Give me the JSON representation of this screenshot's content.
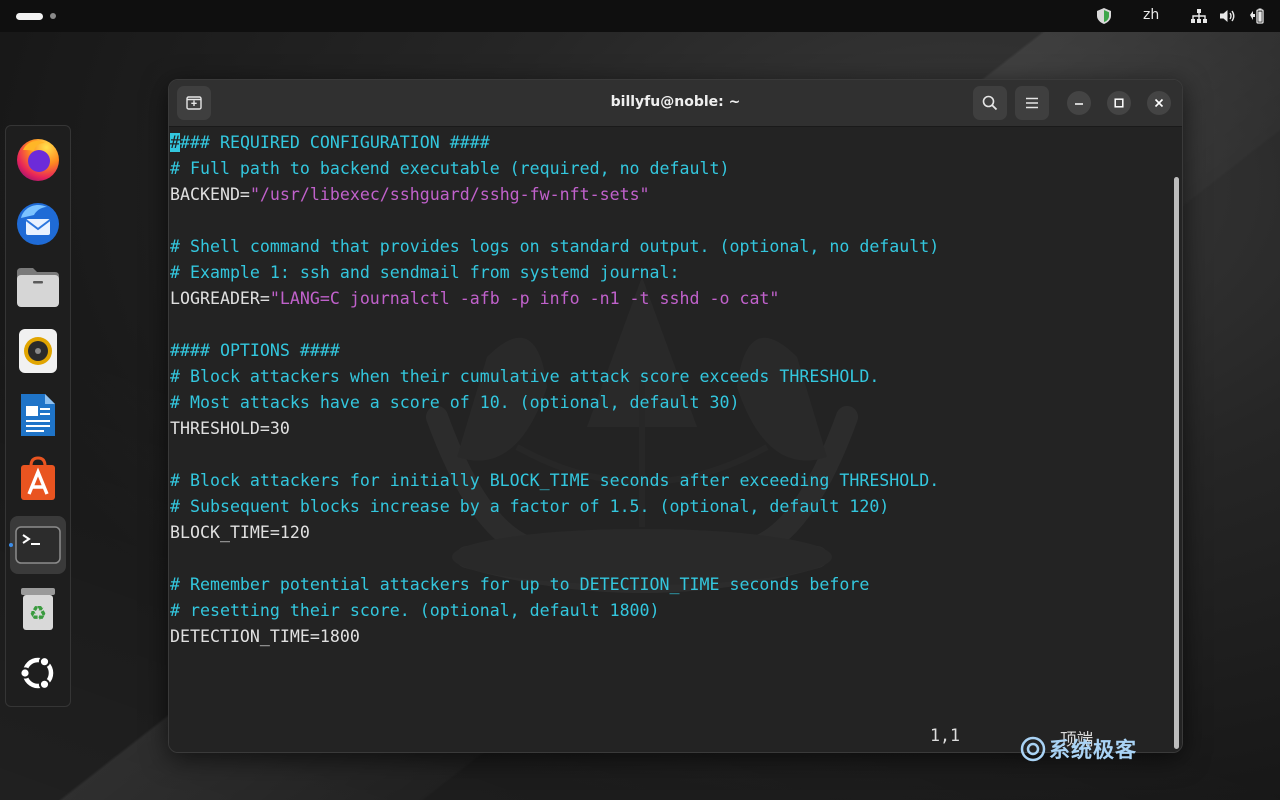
{
  "topbar": {
    "language": "zh"
  },
  "window": {
    "title": "billyfu@noble: ~"
  },
  "dock": {
    "items": [
      "firefox",
      "thunderbird",
      "files",
      "rhythmbox",
      "libreoffice-writer",
      "app-center",
      "terminal",
      "trash",
      "ubuntu-show-apps"
    ]
  },
  "editor": {
    "lines": [
      [
        {
          "t": "#",
          "k": "cursor"
        },
        {
          "t": "### REQUIRED CONFIGURATION ####",
          "k": "c"
        }
      ],
      [
        {
          "t": "# Full path to backend executable (required, no default)",
          "k": "c"
        }
      ],
      [
        {
          "t": "BACKEND=",
          "k": "k"
        },
        {
          "t": "\"/usr/libexec/sshguard/sshg-fw-nft-sets\"",
          "k": "s"
        }
      ],
      [],
      [
        {
          "t": "# Shell command that provides logs on standard output. (optional, no default)",
          "k": "c"
        }
      ],
      [
        {
          "t": "# Example 1: ssh and sendmail from systemd journal:",
          "k": "c"
        }
      ],
      [
        {
          "t": "LOGREADER=",
          "k": "k"
        },
        {
          "t": "\"LANG=C journalctl -afb -p info -n1 -t sshd -o cat\"",
          "k": "s"
        }
      ],
      [],
      [
        {
          "t": "#### OPTIONS ####",
          "k": "c"
        }
      ],
      [
        {
          "t": "# Block attackers when their cumulative attack score exceeds THRESHOLD.",
          "k": "c"
        }
      ],
      [
        {
          "t": "# Most attacks have a score of 10. (optional, default 30)",
          "k": "c"
        }
      ],
      [
        {
          "t": "THRESHOLD=30",
          "k": "k"
        }
      ],
      [],
      [
        {
          "t": "# Block attackers for initially BLOCK_TIME seconds after exceeding THRESHOLD.",
          "k": "c"
        }
      ],
      [
        {
          "t": "# Subsequent blocks increase by a factor of 1.5. (optional, default 120)",
          "k": "c"
        }
      ],
      [
        {
          "t": "BLOCK_TIME=120",
          "k": "k"
        }
      ],
      [],
      [
        {
          "t": "# Remember potential attackers for up to DETECTION_TIME seconds before",
          "k": "c"
        }
      ],
      [
        {
          "t": "# resetting their score. (optional, default 1800)",
          "k": "c"
        }
      ],
      [
        {
          "t": "DETECTION_TIME=1800",
          "k": "k"
        }
      ]
    ],
    "status_position": "1,1",
    "status_scroll": "顶端"
  },
  "watermark": {
    "text": "系统极客"
  },
  "colors": {
    "comment": "#33c7de",
    "string": "#c061cb",
    "text": "#dcdcdc",
    "terminal_bg": "#232323",
    "header_bg": "#303030",
    "running_indicator": "#3c8de8"
  }
}
